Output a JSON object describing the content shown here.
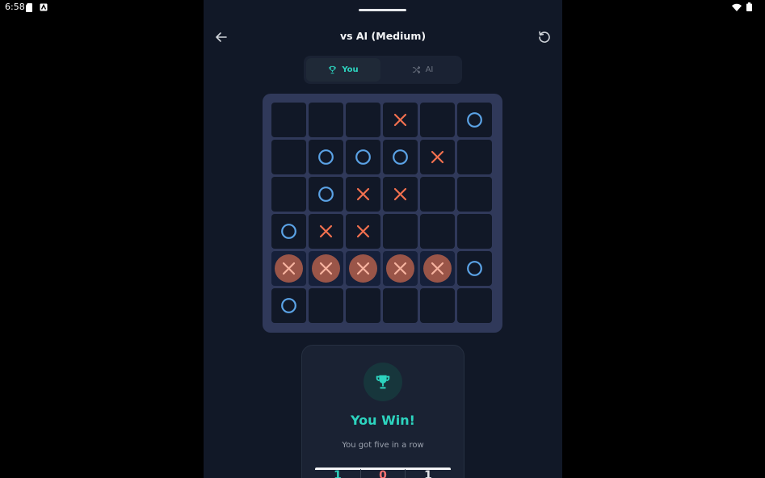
{
  "status_bar": {
    "time": "6:58"
  },
  "header": {
    "title": "vs AI (Medium)"
  },
  "player_toggle": {
    "you_label": "You",
    "ai_label": "AI"
  },
  "board": {
    "size": 6,
    "cells": [
      [
        "",
        "",
        "",
        "X",
        "",
        "O"
      ],
      [
        "",
        "O",
        "O",
        "O",
        "X",
        ""
      ],
      [
        "",
        "O",
        "X",
        "X",
        "",
        ""
      ],
      [
        "O",
        "X",
        "X",
        "",
        "",
        ""
      ],
      [
        "X",
        "X",
        "X",
        "X",
        "X",
        "O"
      ],
      [
        "O",
        "",
        "",
        "",
        "",
        ""
      ]
    ],
    "winning_row": 4,
    "winning_cols": [
      0,
      1,
      2,
      3,
      4
    ]
  },
  "result": {
    "title": "You Win!",
    "subtitle": "You got five in a row",
    "scores": {
      "player": "1",
      "draw": "0",
      "ai": "1"
    }
  },
  "colors": {
    "accent": "#2dd4bf",
    "x_mark": "#f0704f",
    "o_mark": "#5ba3e6",
    "win_highlight": "#9a5548",
    "panel": "#111827"
  }
}
